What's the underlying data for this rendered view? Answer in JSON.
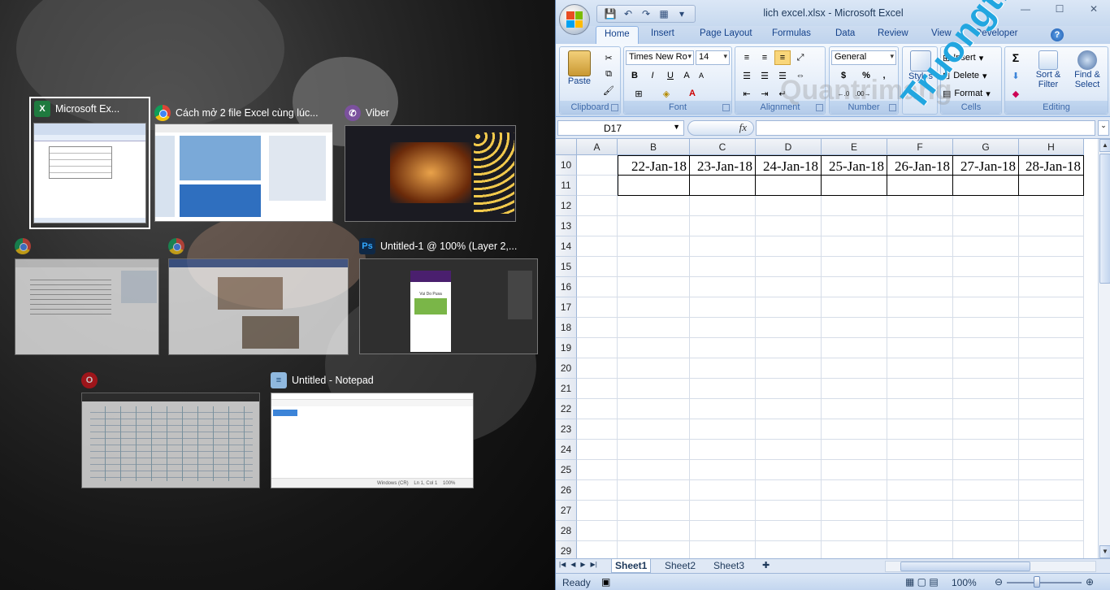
{
  "snap_assist": {
    "windows": [
      {
        "title": "Microsoft Ex...",
        "icon": "excel-icon",
        "selected": true
      },
      {
        "title": "Cách mở 2 file Excel cùng lúc...",
        "icon": "chrome-icon"
      },
      {
        "title": "Viber",
        "icon": "viber-icon"
      },
      {
        "title": "",
        "icon": "chrome-icon"
      },
      {
        "title": "",
        "icon": "chrome-icon"
      },
      {
        "title": "Untitled-1 @ 100% (Layer 2,...",
        "icon": "photoshop-icon"
      },
      {
        "title": "",
        "icon": "opera-icon"
      },
      {
        "title": "Untitled - Notepad",
        "icon": "notepad-icon"
      }
    ],
    "notepad_status": {
      "line_endings": "Windows (CR)",
      "position": "Ln 1, Col 1",
      "zoom": "100%"
    },
    "photoshop_preview_text": "Vui Do Pusa"
  },
  "excel": {
    "title": "lich excel.xlsx - Microsoft Excel",
    "tabs": [
      "Home",
      "Insert",
      "Page Layout",
      "Formulas",
      "Data",
      "Review",
      "View",
      "Developer"
    ],
    "active_tab": "Home",
    "ribbon": {
      "clipboard": {
        "label": "Clipboard",
        "paste": "Paste"
      },
      "font": {
        "label": "Font",
        "name": "Times New Ro",
        "size": "14",
        "bold": "B",
        "italic": "I",
        "underline": "U"
      },
      "alignment": {
        "label": "Alignment"
      },
      "number": {
        "label": "Number",
        "format": "General",
        "currency": "$",
        "percent": "%",
        "comma": ","
      },
      "styles": {
        "label": "Styles"
      },
      "cells": {
        "label": "Cells",
        "insert": "Insert",
        "delete": "Delete",
        "format": "Format"
      },
      "editing": {
        "label": "Editing",
        "sum": "Σ",
        "sort_filter": "Sort & Filter",
        "find_select": "Find & Select"
      }
    },
    "name_box": "D17",
    "fx": "fx",
    "columns": [
      "A",
      "B",
      "C",
      "D",
      "E",
      "F",
      "G",
      "H"
    ],
    "rows": [
      "10",
      "11",
      "12",
      "13",
      "14",
      "15",
      "16",
      "17",
      "18",
      "19",
      "20",
      "21",
      "22",
      "23",
      "24",
      "25",
      "26",
      "27",
      "28",
      "29"
    ],
    "row10_values": [
      "22-Jan-18",
      "23-Jan-18",
      "24-Jan-18",
      "25-Jan-18",
      "26-Jan-18",
      "27-Jan-18",
      "28-Jan-18"
    ],
    "sheets": [
      "Sheet1",
      "Sheet2",
      "Sheet3"
    ],
    "active_sheet": "Sheet1",
    "status": "Ready",
    "zoom": "100%"
  },
  "watermark": "Truongthpt.vn",
  "watermark2": "Quantrimang"
}
